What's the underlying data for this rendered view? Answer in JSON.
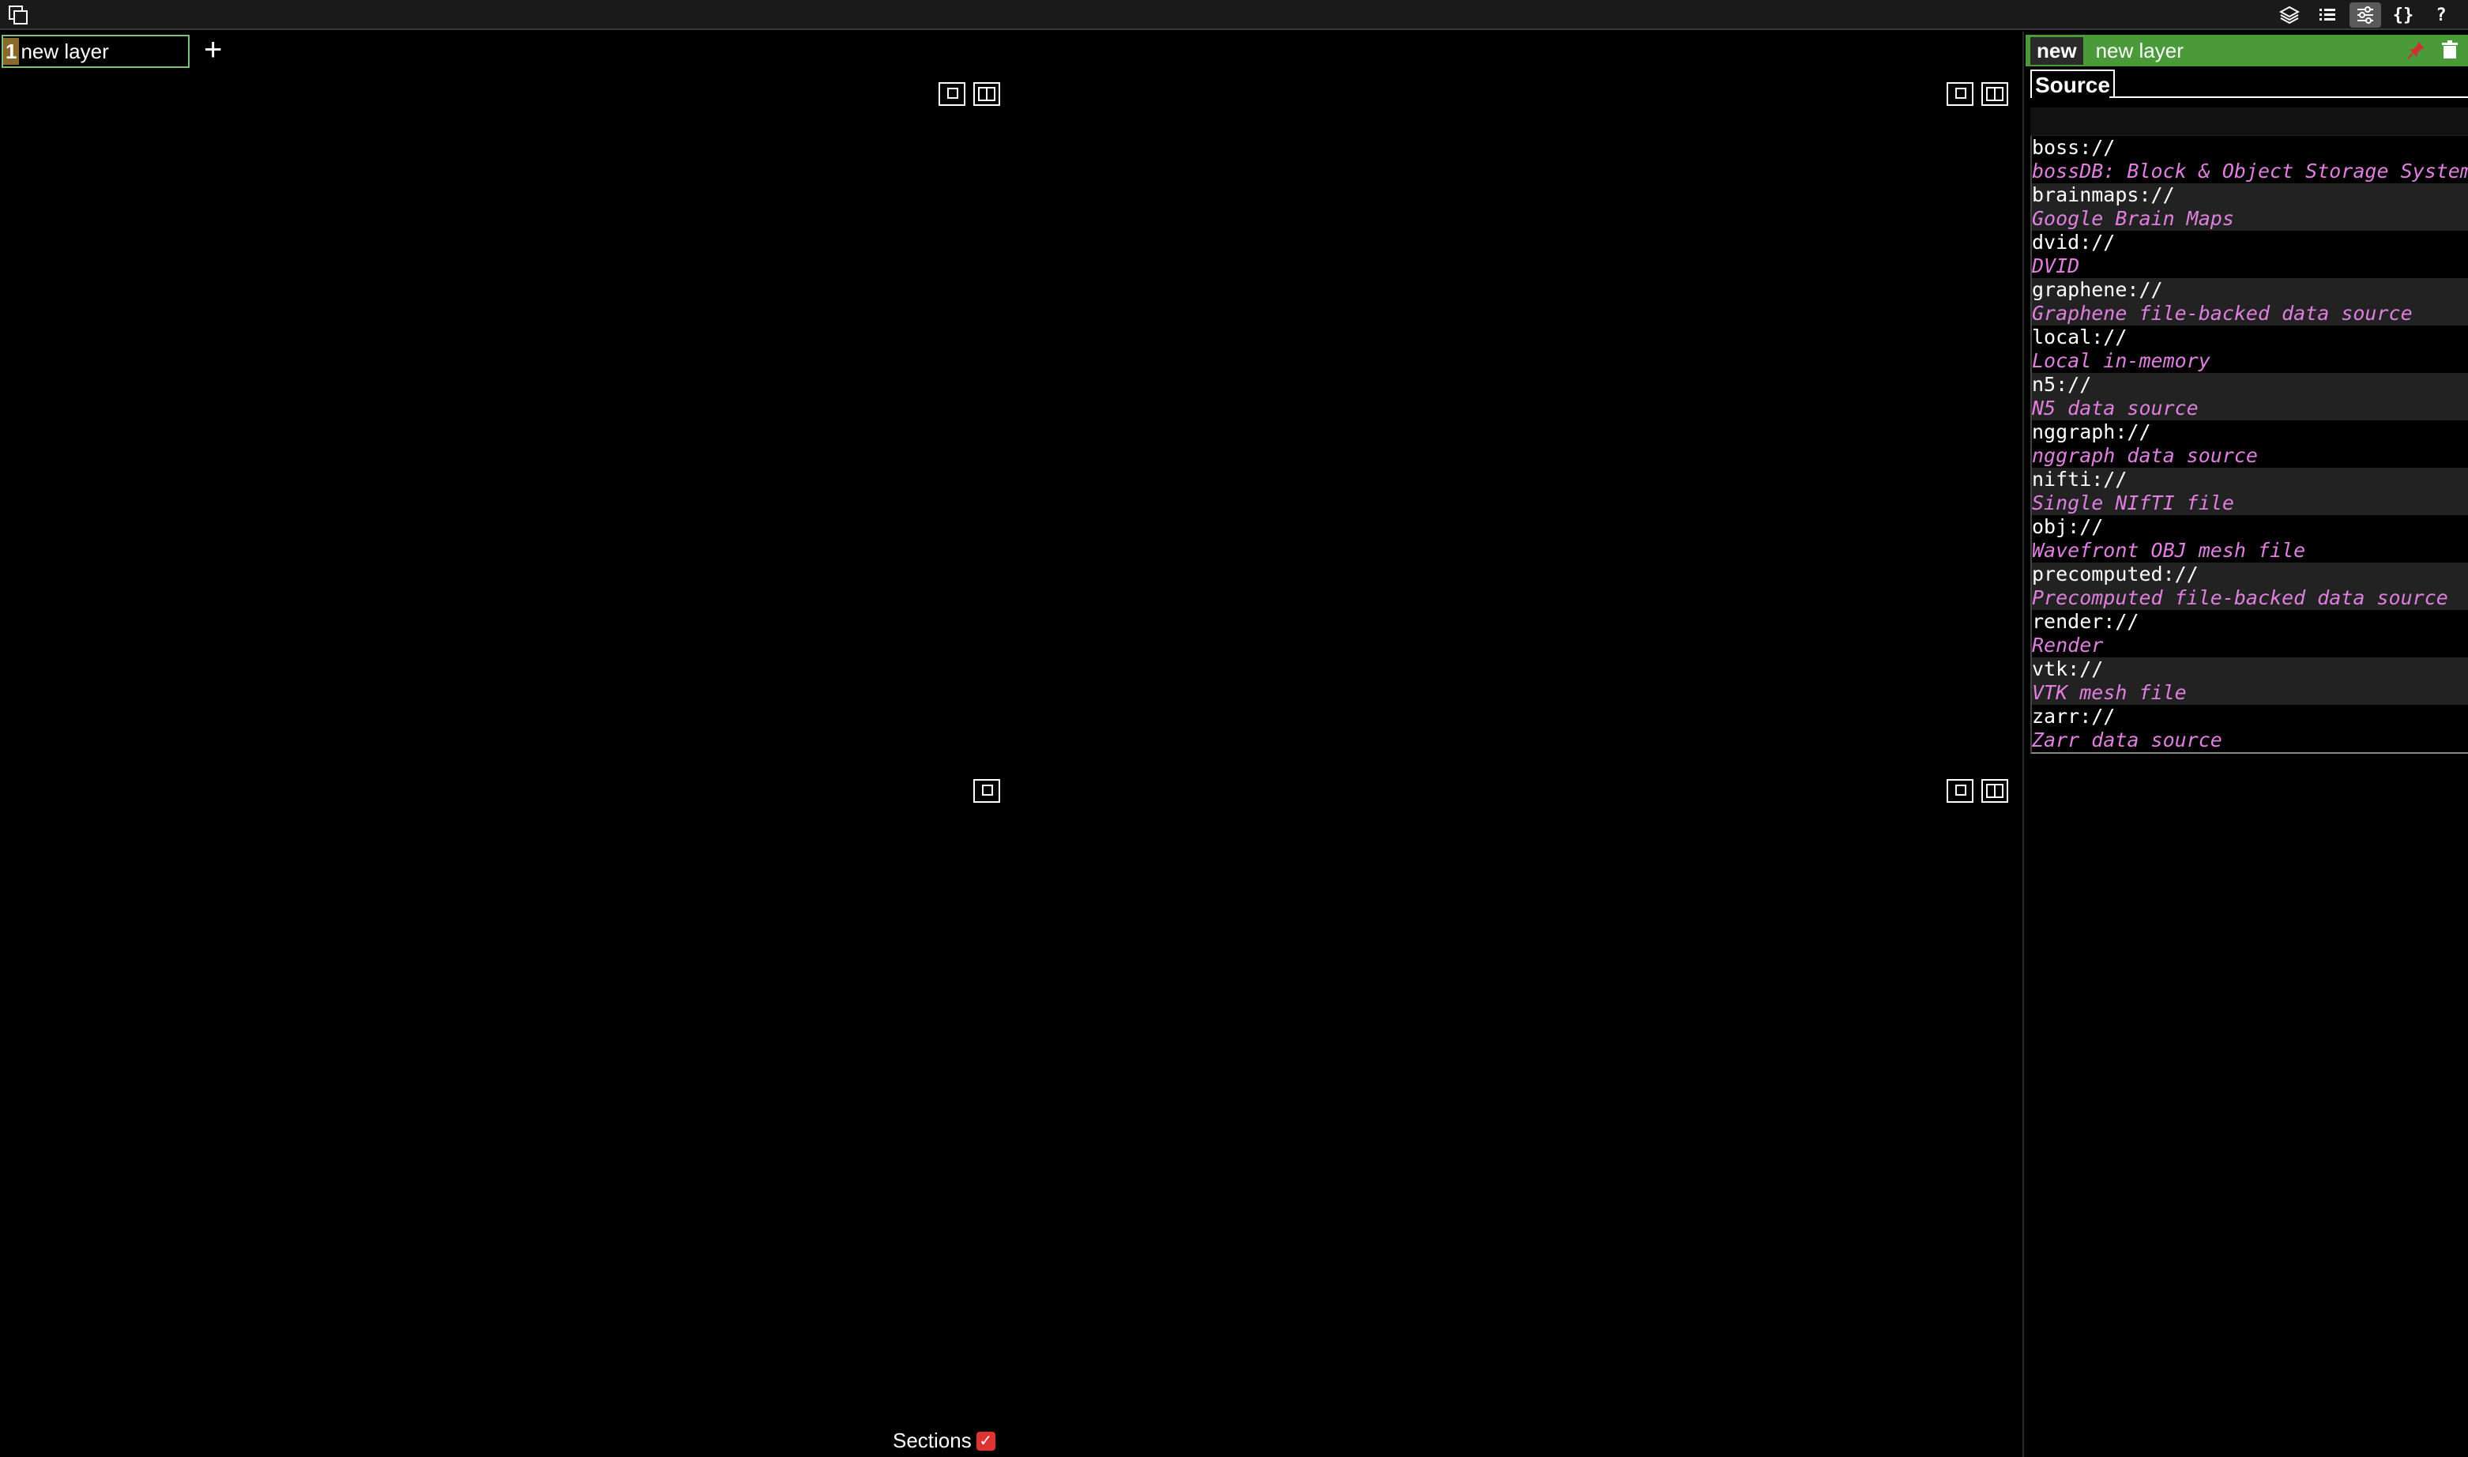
{
  "toolbar": {
    "right_icons": [
      {
        "name": "layers-icon"
      },
      {
        "name": "list-icon"
      },
      {
        "name": "settings-sliders-icon",
        "active": true
      },
      {
        "name": "json-icon",
        "label": "{}"
      },
      {
        "name": "help-icon",
        "label": "?"
      }
    ]
  },
  "layer_bar": {
    "layer_number": "1",
    "layer_name": "new layer",
    "add_symbol": "+"
  },
  "viewer": {
    "sections_label": "Sections",
    "sections_checked": true,
    "checkbox_mark": "✓"
  },
  "side_panel": {
    "badge": "new",
    "layer_name": "new layer",
    "tab_source": "Source",
    "source_value": "",
    "completions": [
      {
        "value": "boss://",
        "description": "bossDB: Block & Object Storage System"
      },
      {
        "value": "brainmaps://",
        "description": "Google Brain Maps"
      },
      {
        "value": "dvid://",
        "description": "DVID"
      },
      {
        "value": "graphene://",
        "description": "Graphene file-backed data source"
      },
      {
        "value": "local://",
        "description": "Local in-memory"
      },
      {
        "value": "n5://",
        "description": "N5 data source"
      },
      {
        "value": "nggraph://",
        "description": "nggraph data source"
      },
      {
        "value": "nifti://",
        "description": "Single NIfTI file"
      },
      {
        "value": "obj://",
        "description": "Wavefront OBJ mesh file"
      },
      {
        "value": "precomputed://",
        "description": "Precomputed file-backed data source"
      },
      {
        "value": "render://",
        "description": "Render"
      },
      {
        "value": "vtk://",
        "description": "VTK mesh file"
      },
      {
        "value": "zarr://",
        "description": "Zarr data source"
      }
    ]
  },
  "colors": {
    "header_green": "#4a9a3a",
    "description_pink": "#e07fe0",
    "checkbox_red": "#dd3333"
  }
}
